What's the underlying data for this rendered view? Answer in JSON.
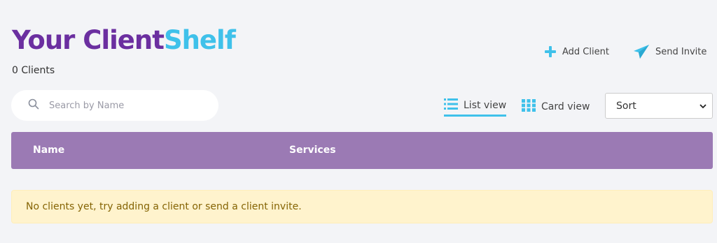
{
  "header": {
    "title_part1": "Your Client",
    "title_part2": "Shelf",
    "client_count": "0 Clients"
  },
  "actions": {
    "add_client": "Add Client",
    "send_invite": "Send Invite"
  },
  "search": {
    "placeholder": "Search by Name",
    "value": ""
  },
  "views": {
    "list_label": "List view",
    "card_label": "Card view",
    "active": "list"
  },
  "sort": {
    "selected": "Sort"
  },
  "table": {
    "columns": [
      "Name",
      "Services"
    ]
  },
  "empty_message": "No clients yet, try adding a client or send a client invite.",
  "colors": {
    "brand_purple": "#6b2fa0",
    "brand_blue": "#3fc1ea",
    "header_bg": "#9b7ab4",
    "alert_bg": "#fff3cd",
    "alert_text": "#856404"
  }
}
